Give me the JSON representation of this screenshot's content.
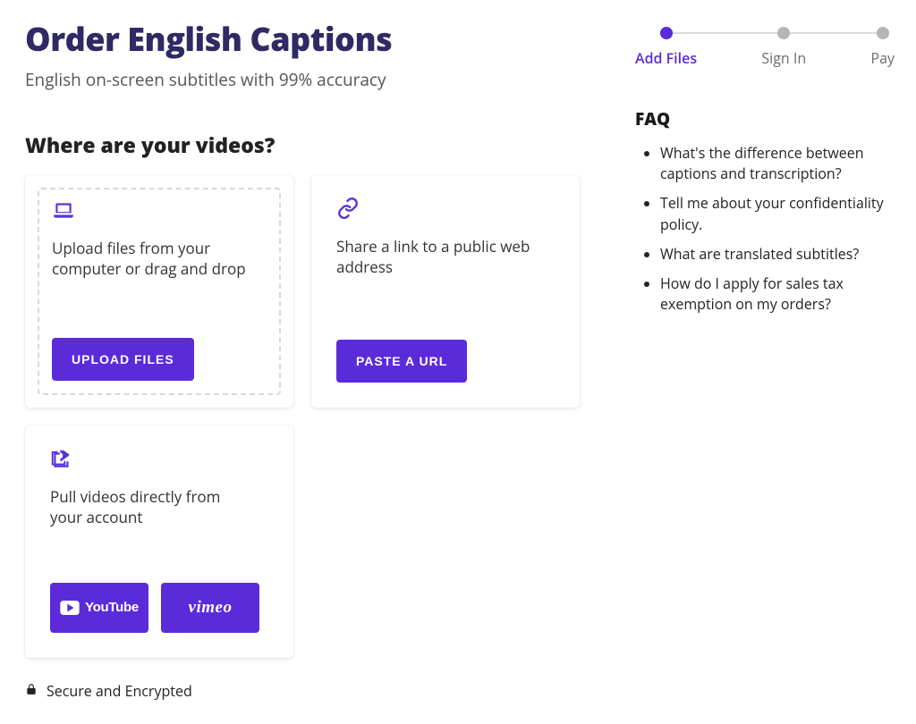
{
  "header": {
    "title": "Order English Captions",
    "subtitle": "English on-screen subtitles with 99% accuracy"
  },
  "section_heading": "Where are your videos?",
  "cards": {
    "upload": {
      "text": "Upload files from your computer or drag and drop",
      "button": "UPLOAD FILES"
    },
    "paste": {
      "text": "Share a link to a public web address",
      "button": "PASTE A URL"
    },
    "pull": {
      "text": "Pull videos directly from your account",
      "youtube": "YouTube",
      "vimeo": "vimeo"
    }
  },
  "secure_text": "Secure and Encrypted",
  "stepper": {
    "steps": [
      {
        "label": "Add Files",
        "active": true
      },
      {
        "label": "Sign In",
        "active": false
      },
      {
        "label": "Pay",
        "active": false
      }
    ]
  },
  "faq": {
    "title": "FAQ",
    "items": [
      "What's the difference between captions and transcription?",
      "Tell me about your confidentiality policy.",
      "What are translated subtitles?",
      "How do I apply for sales tax exemption on my orders?"
    ]
  }
}
